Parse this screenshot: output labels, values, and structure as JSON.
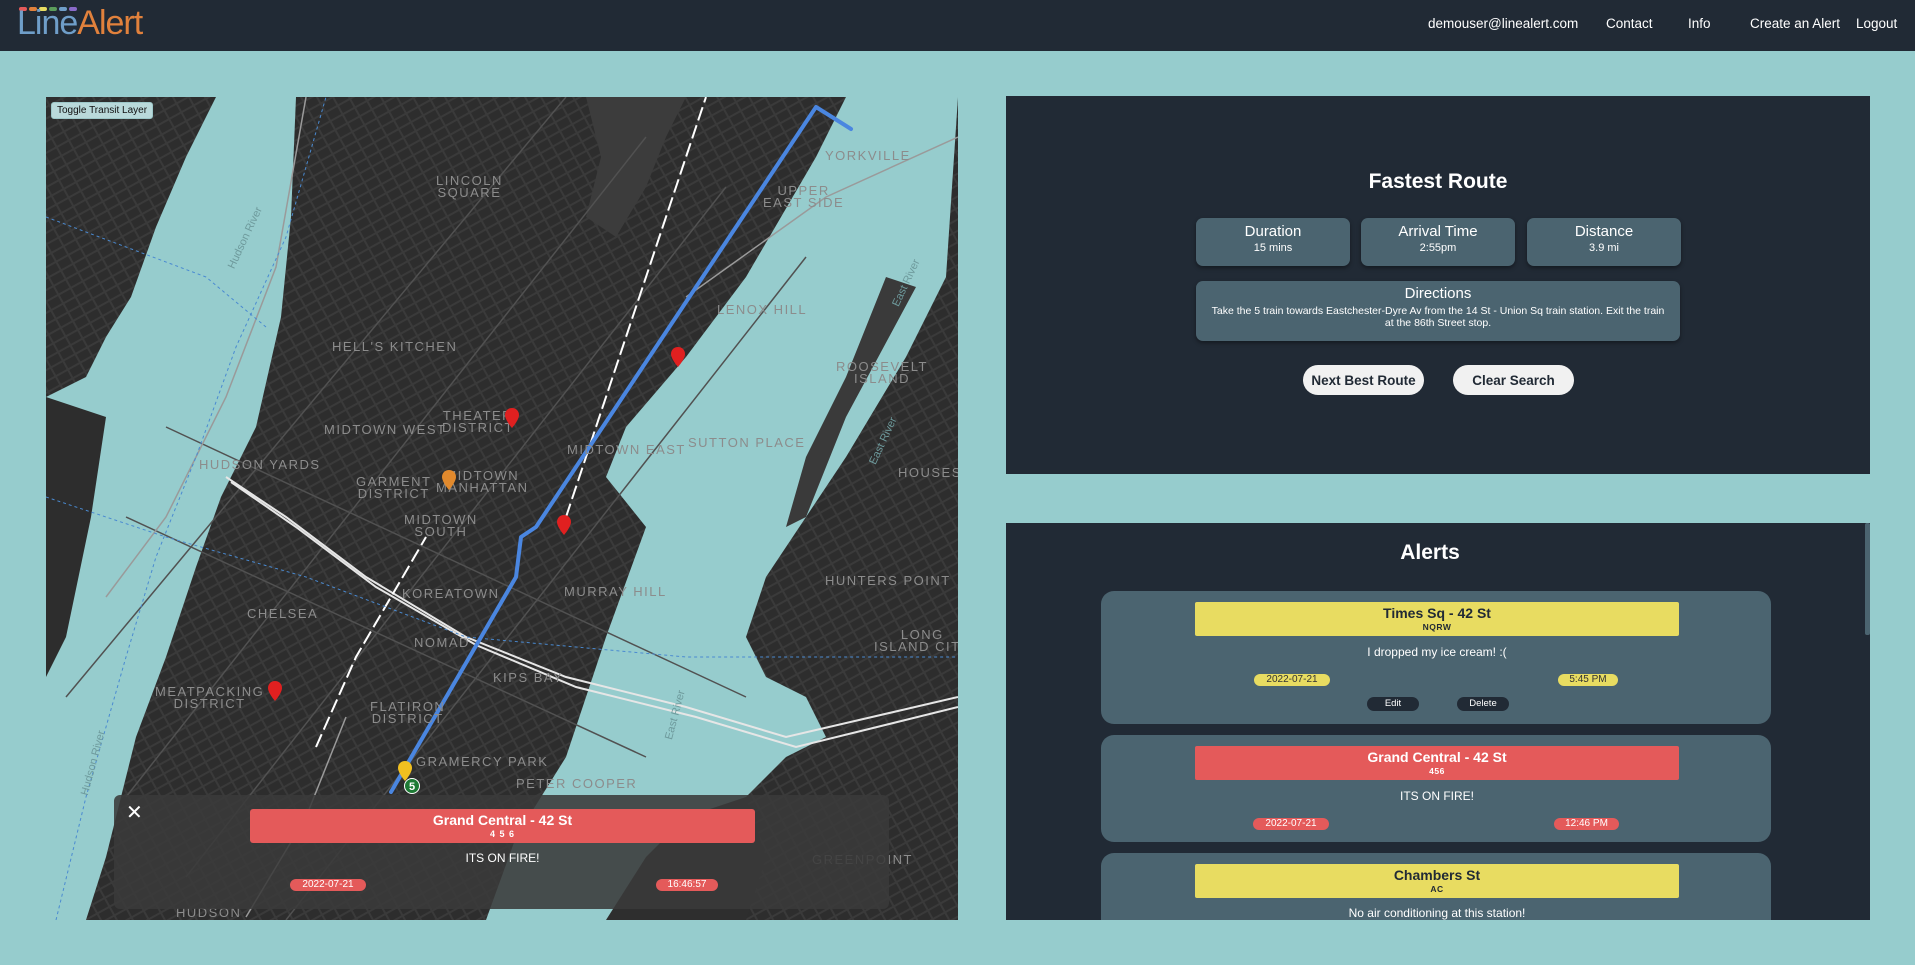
{
  "brand": {
    "part1": "Line",
    "part2": "Alert",
    "bar_colors": [
      "#e45a5a",
      "#e1813c",
      "#e8dc61",
      "#5b9d5b",
      "#6f9ec9",
      "#8a6ac9"
    ]
  },
  "nav": {
    "user": "demouser@linealert.com",
    "contact": "Contact",
    "info": "Info",
    "create": "Create an Alert",
    "logout": "Logout"
  },
  "map": {
    "toggle_label": "Toggle Transit Layer",
    "neighborhoods": {
      "yorkville": "YORKVILLE",
      "lincoln_square": "LINCOLN\nSQUARE",
      "upper_east_side": "UPPER\nEAST SIDE",
      "lenox_hill": "LENOX HILL",
      "hells_kitchen": "HELL'S KITCHEN",
      "roosevelt_island": "ROOSEVELT\nISLAND",
      "theater_district": "THEATER\nDISTRICT",
      "midtown_west": "MIDTOWN WEST",
      "sutton_place": "SUTTON PLACE",
      "hudson_yards": "HUDSON YARDS",
      "garment_district": "GARMENT\nDISTRICT",
      "midtown_manhattan": "MIDTOWN\nMANHATTAN",
      "midtown_east": "MIDTOWN EAST",
      "houses": "HOUSES",
      "midtown_south": "MIDTOWN\nSOUTH",
      "koreatown": "KOREATOWN",
      "murray_hill": "MURRAY HILL",
      "hunters_point": "HUNTERS POINT",
      "chelsea": "CHELSEA",
      "nomad": "NOMAD",
      "long_island_city": "LONG\nISLAND CITY",
      "kips_bay": "KIPS BAY",
      "meatpacking": "MEATPACKING\nDISTRICT",
      "flatiron": "FLATIRON\nDISTRICT",
      "gramercy": "GRAMERCY PARK",
      "peter_cooper": "PETER COOPER",
      "greenpoint": "GREENPOINT",
      "hudson_bottom": "HUDSON"
    },
    "water": {
      "hudson_river": "Hudson River",
      "east_river_1": "East River",
      "east_river_2": "East River",
      "east_river_3": "East River",
      "hudson_river_2": "Hudson River"
    },
    "train_badge": "5",
    "popup": {
      "close": "✕",
      "station": "Grand Central - 42 St",
      "lines": "4 5 6",
      "message": "ITS ON FIRE!",
      "date": "2022-07-21",
      "time": "16:46:57"
    }
  },
  "route": {
    "title": "Fastest Route",
    "duration_label": "Duration",
    "duration_value": "15 mins",
    "arrival_label": "Arrival Time",
    "arrival_value": "2:55pm",
    "distance_label": "Distance",
    "distance_value": "3.9 mi",
    "directions_label": "Directions",
    "directions_text": "Take the 5 train towards Eastchester-Dyre Av from the 14 St - Union Sq train station. Exit the train at the 86th Street stop.",
    "next_button": "Next Best Route",
    "clear_button": "Clear Search"
  },
  "alerts": {
    "title": "Alerts",
    "items": [
      {
        "station": "Times Sq - 42 St",
        "lines": "NQRW",
        "message": "I dropped my ice cream! :(",
        "date": "2022-07-21",
        "time": "5:45 PM",
        "edit": "Edit",
        "delete": "Delete",
        "color": "yellow"
      },
      {
        "station": "Grand Central - 42 St",
        "lines": "456",
        "message": "ITS ON FIRE!",
        "date": "2022-07-21",
        "time": "12:46 PM",
        "color": "red"
      },
      {
        "station": "Chambers St",
        "lines": "AC",
        "message": "No air conditioning at this station!",
        "color": "yellow"
      }
    ]
  }
}
